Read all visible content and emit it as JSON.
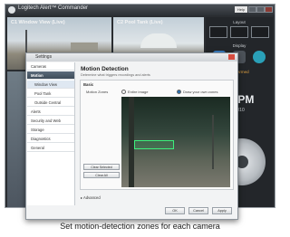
{
  "app": {
    "title": "Logitech Alert™ Commander",
    "help_label": "Help"
  },
  "cameras": [
    {
      "label": "C1 Window View (Live)"
    },
    {
      "label": "C2 Pool Tank (Live)"
    }
  ],
  "sidebar": {
    "layout_label": "Layout",
    "display_label": "Display",
    "time": "3:26 PM",
    "date": "March 16, 2010",
    "status": "Not Armed"
  },
  "dialog": {
    "title": "Settings",
    "nav": [
      {
        "label": "Cameras"
      },
      {
        "label": "Motion"
      },
      {
        "label": "Window View"
      },
      {
        "label": "Pool Tank"
      },
      {
        "label": "Outside Central"
      },
      {
        "label": "Alerts"
      },
      {
        "label": "Security and Web"
      },
      {
        "label": "Storage"
      },
      {
        "label": "Diagnostics"
      },
      {
        "label": "General"
      }
    ],
    "heading": "Motion Detection",
    "description": "Determine what triggers recordings and alerts",
    "basic_label": "Basic",
    "motion_zones_label": "Motion Zones",
    "option_entire": "Entire image",
    "option_draw": "Draw your own zones",
    "clear_selected": "Clear Selected",
    "clear_all": "Clear All",
    "advanced_label": "Advanced",
    "ok": "OK",
    "cancel": "Cancel",
    "apply": "Apply"
  },
  "caption": "Set motion-detection zones for each camera"
}
